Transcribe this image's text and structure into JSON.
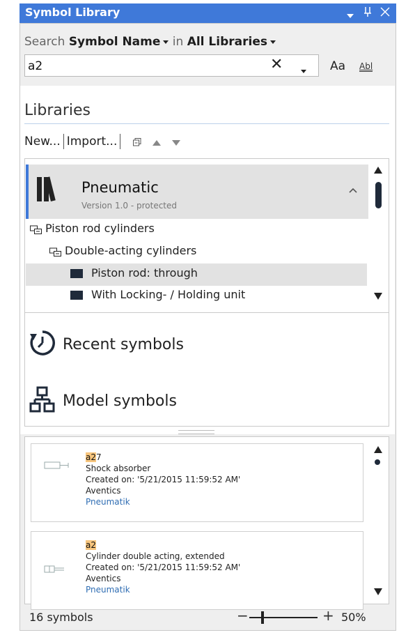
{
  "window": {
    "title": "Symbol Library"
  },
  "search": {
    "prefix": "Search",
    "field": "Symbol Name",
    "in_text": "in",
    "scope": "All Libraries",
    "value": "a2",
    "case_label": "Aa",
    "whole_word_label": "Abl"
  },
  "libraries": {
    "heading": "Libraries",
    "new_label": "New...",
    "import_label": "Import...",
    "library": {
      "name": "Pneumatic",
      "version": "Version 1.0 - protected"
    },
    "tree": [
      {
        "label": "Piston rod cylinders"
      },
      {
        "label": "Double-acting cylinders"
      },
      {
        "label": "Piston rod: through"
      },
      {
        "label": "With Locking- / Holding unit"
      }
    ]
  },
  "sections": {
    "recent": "Recent symbols",
    "model": "Model symbols"
  },
  "results": [
    {
      "match": "a2",
      "rest": "7",
      "description": "Shock absorber",
      "created": "Created on: '5/21/2015 11:59:52 AM'",
      "vendor": "Aventics",
      "library": "Pneumatik"
    },
    {
      "match": "a2",
      "rest": "",
      "description": "Cylinder double acting, extended",
      "created": "Created on: '5/21/2015 11:59:52 AM'",
      "vendor": "Aventics",
      "library": "Pneumatik"
    }
  ],
  "status": {
    "count": "16 symbols",
    "zoom": "50%"
  },
  "colors": {
    "accent": "#3f79d9",
    "highlight": "#f8c67e",
    "selection": "#e2e2e2"
  }
}
